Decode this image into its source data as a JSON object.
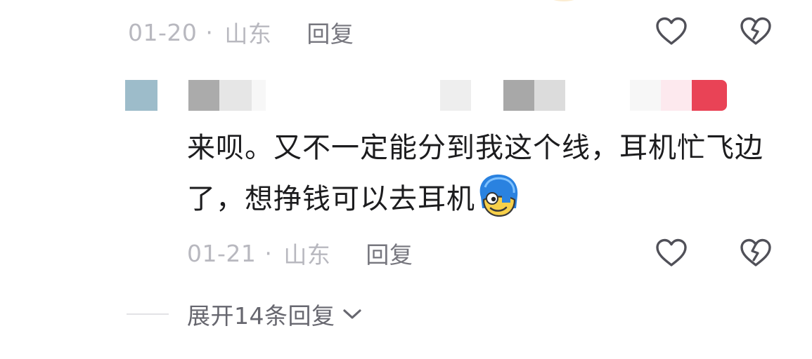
{
  "comment": {
    "date": "01-20",
    "separator": "·",
    "location": "山东",
    "reply_label": "回复"
  },
  "reply": {
    "text": "来呗。又不一定能分到我这个线，耳机忙飞边了，想挣钱可以去耳机",
    "emoji": "blue-hair-grin-emoji",
    "date": "01-21",
    "separator": "·",
    "location": "山东",
    "reply_label": "回复"
  },
  "expand": {
    "label": "展开14条回复"
  },
  "icons": {
    "like": "heart-outline-icon",
    "dislike": "broken-heart-outline-icon",
    "expand": "chevron-down-icon"
  },
  "colors": {
    "meta_text": "#b8b8bf",
    "reply_action": "#76767e",
    "body_text": "#1c1c1e",
    "icon": "#505058",
    "mosaic_red": "#e94356",
    "mosaic_blue": "#9dbcca"
  }
}
